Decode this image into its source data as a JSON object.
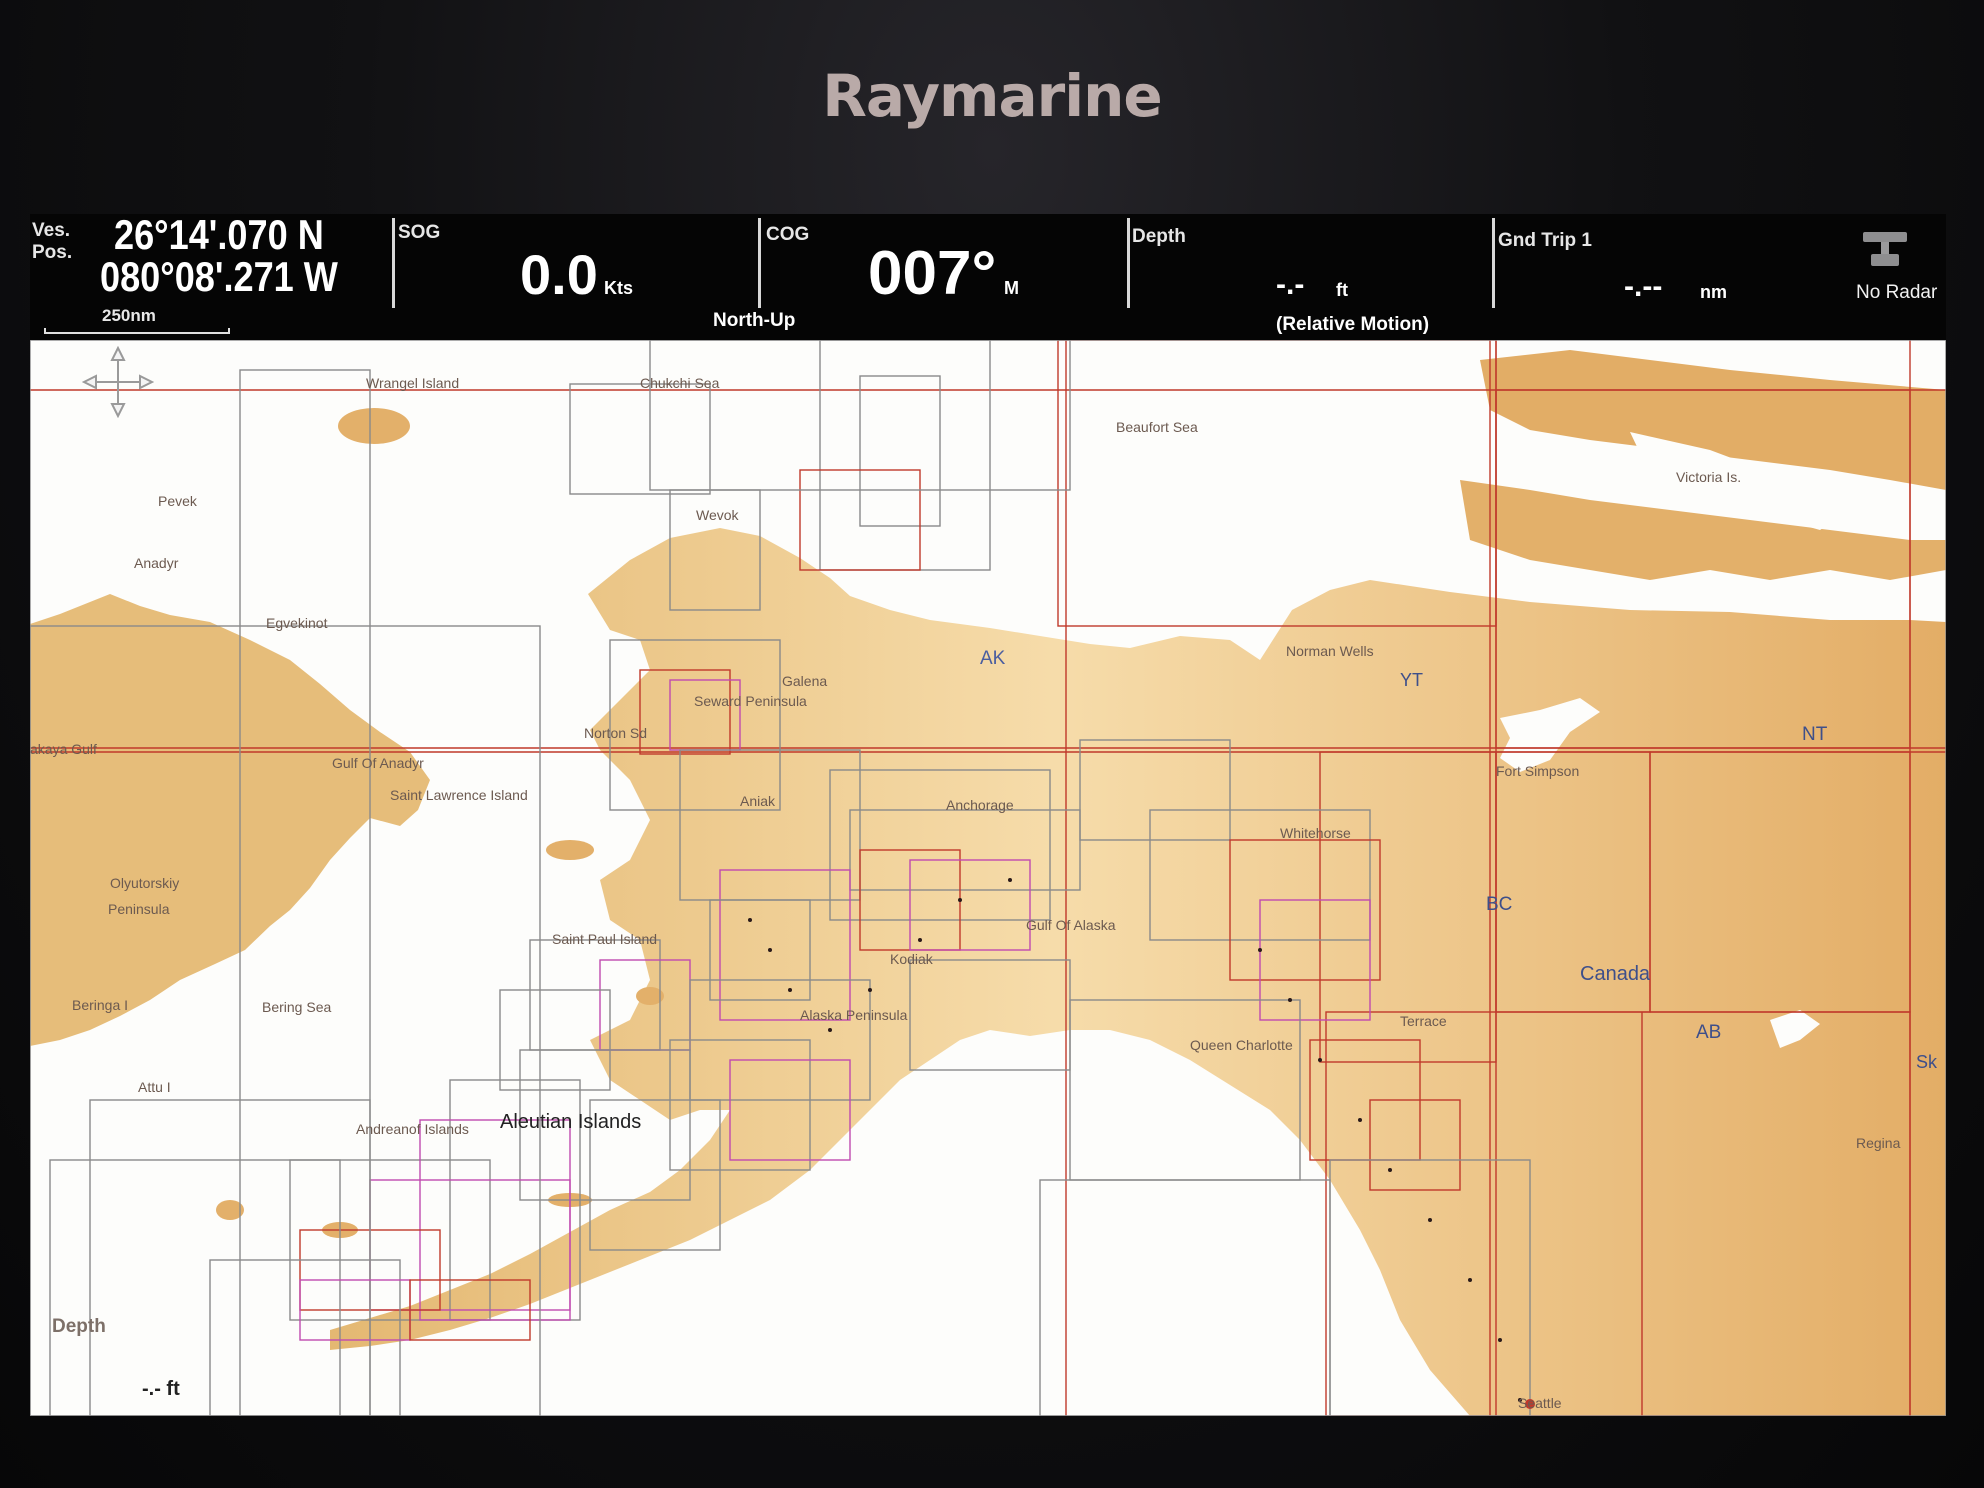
{
  "device": {
    "brand": "Raymarine"
  },
  "databar": {
    "position": {
      "label_line1": "Ves.",
      "label_line2": "Pos.",
      "lat": "26°14'.070 N",
      "lon": "080°08'.271 W"
    },
    "sog": {
      "label": "SOG",
      "value": "0.0",
      "unit": "Kts"
    },
    "cog": {
      "label": "COG",
      "value": "007°",
      "unit": "M"
    },
    "depth": {
      "label": "Depth",
      "value": "-.-",
      "unit": "ft"
    },
    "gnd_trip": {
      "label": "Gnd Trip 1",
      "value": "-.--",
      "unit": "nm"
    },
    "radar": {
      "status": "No Radar",
      "icon": "radar-icon"
    }
  },
  "overlay": {
    "scale": "250nm",
    "orientation": "North-Up",
    "motion_mode": "(Relative Motion)",
    "depth_label": "Depth",
    "depth_value": "-.- ft"
  },
  "colors": {
    "land": "#e9c27c",
    "land_dark": "#d9a760",
    "water": "#ffffff",
    "grid_red": "#c0392b",
    "grid_pink": "#c04ab0",
    "grid_gray": "#8a8a8a"
  },
  "map_labels": {
    "wrangel": "Wrangel Island",
    "chukchi": "Chukchi Sea",
    "beaufort": "Beaufort Sea",
    "victoria": "Victoria Is.",
    "pevek": "Pevek",
    "anadyr": "Anadyr",
    "egvekinot": "Egvekinot",
    "wevok": "Wevok",
    "ak": "AK",
    "norman_wells": "Norman Wells",
    "yt": "YT",
    "nt": "NT",
    "galena": "Galena",
    "seward": "Seward Peninsula",
    "norton": "Norton Sd",
    "akaya": "akaya Gulf",
    "gulf_anadyr": "Gulf Of Anadyr",
    "st_lawrence": "Saint Lawrence Island",
    "fort_simpson": "Fort Simpson",
    "aniak": "Aniak",
    "anchorage": "Anchorage",
    "whitehorse": "Whitehorse",
    "olyutorskiy": "Olyutorskiy",
    "peninsula": "Peninsula",
    "bc": "BC",
    "gulf_alaska": "Gulf Of Alaska",
    "st_paul": "Saint Paul Island",
    "kodiak": "Kodiak",
    "canada": "Canada",
    "beringa": "Beringa I",
    "bering_sea": "Bering Sea",
    "alaska_pen": "Alaska Peninsula",
    "terrace": "Terrace",
    "ab": "AB",
    "queen_charlotte": "Queen Charlotte",
    "attu": "Attu I",
    "andreanof": "Andreanof Islands",
    "aleutian": "Aleutian Islands",
    "sk": "Sk",
    "regina": "Regina",
    "seattle": "Seattle"
  }
}
